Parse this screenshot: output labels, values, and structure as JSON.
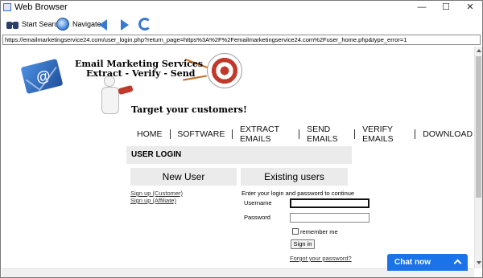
{
  "window": {
    "title": "Web Browser",
    "minimize_glyph": "—",
    "maximize_glyph": "☐",
    "close_glyph": "✕"
  },
  "toolbar": {
    "start_search_label": "Start Search",
    "navigate_label": "Navigate",
    "icons": [
      "binoculars-icon",
      "globe-icon",
      "back-arrow-icon",
      "forward-arrow-icon",
      "refresh-icon"
    ]
  },
  "address_bar": {
    "url": "https://emailmarketingservice24.com/user_login.php?return_page=https%3A%2F%2Femailmarketingservice24.com%2Fuser_home.php&type_error=1"
  },
  "banner": {
    "title": "Email Marketing Services",
    "subtitle": "Extract - Verify - Send",
    "tagline": "Target your customers!",
    "colors": {
      "target_red": "#c0392b",
      "envelope_blue": "#2d6ec8"
    }
  },
  "nav": {
    "items": [
      "HOME",
      "SOFTWARE",
      "EXTRACT EMAILS",
      "SEND EMAILS",
      "VERIFY EMAILS",
      "DOWNLOAD"
    ]
  },
  "login": {
    "heading": "USER LOGIN",
    "new_user_heading": "New User",
    "existing_heading": "Existing users",
    "signup_customer": "Sign up (Customer)",
    "signup_affiliate": "Sign up (Affiliate)",
    "instructions": "Enter your login and password to continue",
    "username_label": "Username",
    "username_value": "",
    "password_label": "Password",
    "password_value": "",
    "remember_label": "remember me",
    "signin_label": "Sign in",
    "forgot_link": "Forgot your password?"
  },
  "chat": {
    "label": "Chat now",
    "color": "#1a73e8"
  }
}
